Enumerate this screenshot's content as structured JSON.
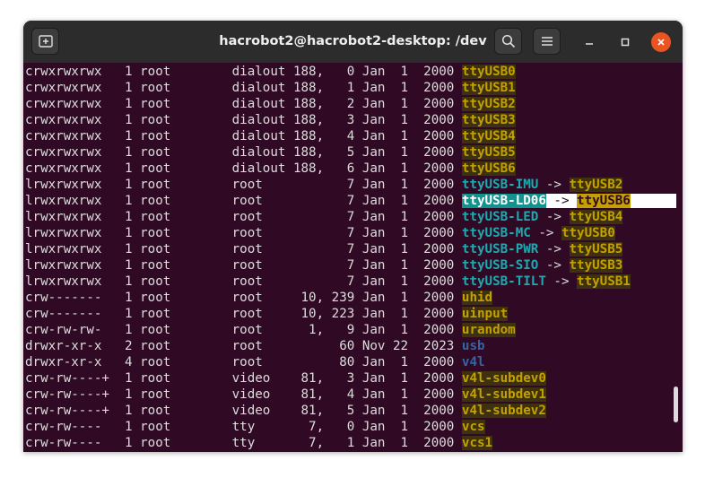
{
  "window": {
    "title": "hacrobot2@hacrobot2-desktop: /dev",
    "icons": {
      "new_tab": "new-tab-icon",
      "search": "search-icon",
      "menu": "hamburger-menu-icon",
      "minimize": "minimize-icon",
      "maximize": "maximize-icon",
      "close": "close-icon"
    }
  },
  "colors": {
    "terminal_bg": "#300a24",
    "titlebar_bg": "#2c2c2c",
    "device_yellow": "#c4a000",
    "link_cyan": "#1eaab0",
    "dir_blue": "#3465a4",
    "close_orange": "#e95420"
  },
  "terminal": {
    "lines": [
      {
        "perm": "crwxrwxrwx",
        "count": "1",
        "owner": "root",
        "group": "dialout",
        "size": "188,   0",
        "month": "Jan",
        "day": "1",
        "year": "2000",
        "name": "ttyUSB0",
        "type": "dev"
      },
      {
        "perm": "crwxrwxrwx",
        "count": "1",
        "owner": "root",
        "group": "dialout",
        "size": "188,   1",
        "month": "Jan",
        "day": "1",
        "year": "2000",
        "name": "ttyUSB1",
        "type": "dev"
      },
      {
        "perm": "crwxrwxrwx",
        "count": "1",
        "owner": "root",
        "group": "dialout",
        "size": "188,   2",
        "month": "Jan",
        "day": "1",
        "year": "2000",
        "name": "ttyUSB2",
        "type": "dev"
      },
      {
        "perm": "crwxrwxrwx",
        "count": "1",
        "owner": "root",
        "group": "dialout",
        "size": "188,   3",
        "month": "Jan",
        "day": "1",
        "year": "2000",
        "name": "ttyUSB3",
        "type": "dev"
      },
      {
        "perm": "crwxrwxrwx",
        "count": "1",
        "owner": "root",
        "group": "dialout",
        "size": "188,   4",
        "month": "Jan",
        "day": "1",
        "year": "2000",
        "name": "ttyUSB4",
        "type": "dev"
      },
      {
        "perm": "crwxrwxrwx",
        "count": "1",
        "owner": "root",
        "group": "dialout",
        "size": "188,   5",
        "month": "Jan",
        "day": "1",
        "year": "2000",
        "name": "ttyUSB5",
        "type": "dev"
      },
      {
        "perm": "crwxrwxrwx",
        "count": "1",
        "owner": "root",
        "group": "dialout",
        "size": "188,   6",
        "month": "Jan",
        "day": "1",
        "year": "2000",
        "name": "ttyUSB6",
        "type": "dev"
      },
      {
        "perm": "lrwxrwxrwx",
        "count": "1",
        "owner": "root",
        "group": "root",
        "size": "7",
        "month": "Jan",
        "day": "1",
        "year": "2000",
        "name": "ttyUSB-IMU",
        "type": "link",
        "target": "ttyUSB2"
      },
      {
        "perm": "lrwxrwxrwx",
        "count": "1",
        "owner": "root",
        "group": "root",
        "size": "7",
        "month": "Jan",
        "day": "1",
        "year": "2000",
        "name": "ttyUSB-LD06",
        "type": "link-hl",
        "target": "ttyUSB6"
      },
      {
        "perm": "lrwxrwxrwx",
        "count": "1",
        "owner": "root",
        "group": "root",
        "size": "7",
        "month": "Jan",
        "day": "1",
        "year": "2000",
        "name": "ttyUSB-LED",
        "type": "link",
        "target": "ttyUSB4"
      },
      {
        "perm": "lrwxrwxrwx",
        "count": "1",
        "owner": "root",
        "group": "root",
        "size": "7",
        "month": "Jan",
        "day": "1",
        "year": "2000",
        "name": "ttyUSB-MC",
        "type": "link",
        "target": "ttyUSB0"
      },
      {
        "perm": "lrwxrwxrwx",
        "count": "1",
        "owner": "root",
        "group": "root",
        "size": "7",
        "month": "Jan",
        "day": "1",
        "year": "2000",
        "name": "ttyUSB-PWR",
        "type": "link",
        "target": "ttyUSB5"
      },
      {
        "perm": "lrwxrwxrwx",
        "count": "1",
        "owner": "root",
        "group": "root",
        "size": "7",
        "month": "Jan",
        "day": "1",
        "year": "2000",
        "name": "ttyUSB-SIO",
        "type": "link",
        "target": "ttyUSB3"
      },
      {
        "perm": "lrwxrwxrwx",
        "count": "1",
        "owner": "root",
        "group": "root",
        "size": "7",
        "month": "Jan",
        "day": "1",
        "year": "2000",
        "name": "ttyUSB-TILT",
        "type": "link",
        "target": "ttyUSB1"
      },
      {
        "perm": "crw-------",
        "count": "1",
        "owner": "root",
        "group": "root",
        "size": "10, 239",
        "month": "Jan",
        "day": "1",
        "year": "2000",
        "name": "uhid",
        "type": "dev"
      },
      {
        "perm": "crw-------",
        "count": "1",
        "owner": "root",
        "group": "root",
        "size": "10, 223",
        "month": "Jan",
        "day": "1",
        "year": "2000",
        "name": "uinput",
        "type": "dev"
      },
      {
        "perm": "crw-rw-rw-",
        "count": "1",
        "owner": "root",
        "group": "root",
        "size": "1,   9",
        "month": "Jan",
        "day": "1",
        "year": "2000",
        "name": "urandom",
        "type": "dev"
      },
      {
        "perm": "drwxr-xr-x",
        "count": "2",
        "owner": "root",
        "group": "root",
        "size": "60",
        "month": "Nov",
        "day": "22",
        "year": "2023",
        "name": "usb",
        "type": "dir"
      },
      {
        "perm": "drwxr-xr-x",
        "count": "4",
        "owner": "root",
        "group": "root",
        "size": "80",
        "month": "Jan",
        "day": "1",
        "year": "2000",
        "name": "v4l",
        "type": "dir"
      },
      {
        "perm": "crw-rw----+",
        "count": "1",
        "owner": "root",
        "group": "video",
        "size": "81,   3",
        "month": "Jan",
        "day": "1",
        "year": "2000",
        "name": "v4l-subdev0",
        "type": "dev"
      },
      {
        "perm": "crw-rw----+",
        "count": "1",
        "owner": "root",
        "group": "video",
        "size": "81,   4",
        "month": "Jan",
        "day": "1",
        "year": "2000",
        "name": "v4l-subdev1",
        "type": "dev"
      },
      {
        "perm": "crw-rw----+",
        "count": "1",
        "owner": "root",
        "group": "video",
        "size": "81,   5",
        "month": "Jan",
        "day": "1",
        "year": "2000",
        "name": "v4l-subdev2",
        "type": "dev"
      },
      {
        "perm": "crw-rw----",
        "count": "1",
        "owner": "root",
        "group": "tty",
        "size": "7,   0",
        "month": "Jan",
        "day": "1",
        "year": "2000",
        "name": "vcs",
        "type": "dev"
      },
      {
        "perm": "crw-rw----",
        "count": "1",
        "owner": "root",
        "group": "tty",
        "size": "7,   1",
        "month": "Jan",
        "day": "1",
        "year": "2000",
        "name": "vcs1",
        "type": "dev"
      }
    ]
  }
}
